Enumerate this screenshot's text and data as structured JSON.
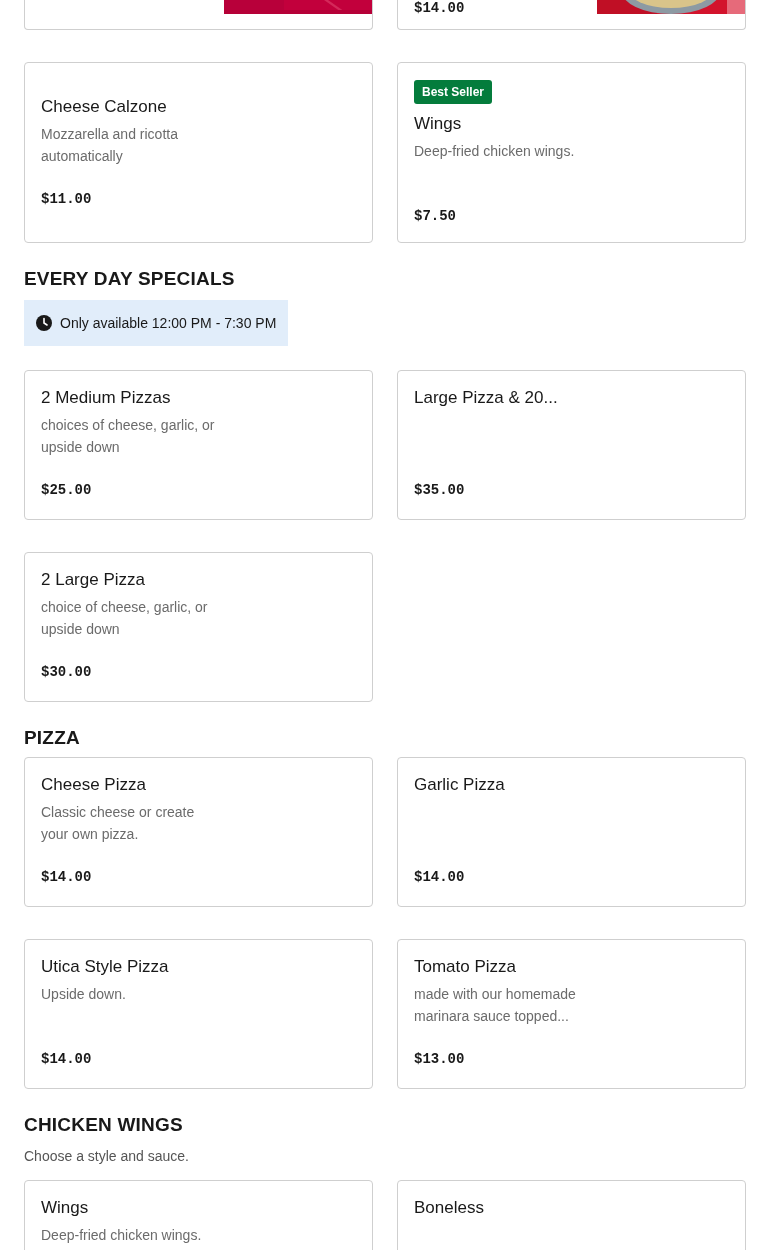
{
  "sections": [
    {
      "items": [
        {
          "image": {
            "kind": "picture"
          }
        },
        {
          "price": "$14.00",
          "image": {
            "kind": "picture"
          }
        }
      ]
    },
    {
      "items": [
        {
          "name": "Cheese Calzone",
          "description": "Mozzarella and ricotta automatically",
          "price": "$11.00"
        },
        {
          "badge": "Best Seller",
          "name": "Wings",
          "description": "Deep-fried chicken wings.",
          "price": "$7.50"
        }
      ]
    },
    {
      "heading": "EVERY DAY SPECIALS",
      "notice": "Only available 12:00 PM - 7:30 PM",
      "items": [
        {
          "name": "2 Medium Pizzas",
          "description": "choices of cheese, garlic, or upside down",
          "price": "$25.00"
        },
        {
          "name": "Large Pizza & 20...",
          "price": "$35.00"
        },
        {
          "name": "2 Large Pizza",
          "description": "choice of cheese, garlic, or upside down",
          "price": "$30.00"
        }
      ]
    },
    {
      "heading": "PIZZA",
      "items": [
        {
          "name": "Cheese Pizza",
          "description": "Classic cheese or create your own pizza.",
          "price": "$14.00"
        },
        {
          "name": "Garlic Pizza",
          "price": "$14.00"
        },
        {
          "name": "Utica Style Pizza",
          "description": "Upside down.",
          "price": "$14.00"
        },
        {
          "name": "Tomato Pizza",
          "description": "made with our homemade marinara sauce topped...",
          "price": "$13.00"
        }
      ]
    },
    {
      "heading": "CHICKEN WINGS",
      "subtitle": "Choose a style and sauce.",
      "items": [
        {
          "name": "Wings",
          "description": "Deep-fried chicken wings."
        },
        {
          "name": "Boneless"
        }
      ]
    }
  ]
}
